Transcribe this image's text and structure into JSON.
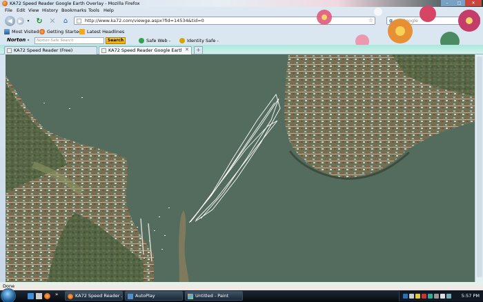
{
  "window": {
    "title": "KA72 Speed Reader Google Earth Overlay - Mozilla Firefox",
    "min_glyph": "–",
    "max_glyph": "□",
    "close_glyph": "✕"
  },
  "menu": [
    "File",
    "Edit",
    "View",
    "History",
    "Bookmarks",
    "Tools",
    "Help"
  ],
  "nav": {
    "url": "http://www.ka72.com/viewge.aspx?fid=14534&tid=0",
    "search_placeholder": "Google",
    "search_logo": "g"
  },
  "bookmarks": [
    "Most Visited",
    "Getting Started",
    "Latest Headlines"
  ],
  "norton": {
    "logo": "Norton -",
    "search_placeholder": "Norton Safe Search",
    "search_button": "Search",
    "safe_web": "Safe Web -",
    "identity_safe": "Identity Safe -"
  },
  "tabs": [
    {
      "label": "KA72 Speed Reader (Free)",
      "close": "✕",
      "active": false
    },
    {
      "label": "KA72 Speed Reader Google Earth...",
      "close": "✕",
      "active": true
    }
  ],
  "new_tab_glyph": "+",
  "status": "Done",
  "taskbar": {
    "more_glyph": "»",
    "buttons": [
      "KA72 Speed Reader ...",
      "AutoPlay",
      "Untitled - Paint"
    ],
    "clock": "5:57 PM"
  },
  "colors": {
    "water": "#4f6a55",
    "land": "#6f7a55",
    "track": "#ffffff",
    "norton_button": "#f0a800"
  },
  "icons": {
    "back": "back-arrow-icon",
    "forward": "forward-arrow-icon",
    "reload": "reload-icon",
    "stop": "stop-icon",
    "home": "home-icon",
    "bookmark_star": "star-icon"
  }
}
